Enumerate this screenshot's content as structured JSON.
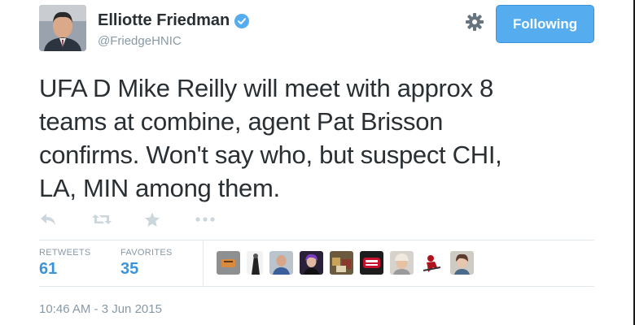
{
  "author": {
    "name": "Elliotte Friedman",
    "handle": "@FriedgeHNIC",
    "verified": true
  },
  "follow_button": {
    "label": "Following"
  },
  "tweet": {
    "lines": [
      "UFA D Mike Reilly will meet with approx 8",
      "teams at combine, agent Pat Brisson",
      "confirms. Won't say who, but suspect CHI,",
      "LA, MIN among them."
    ]
  },
  "actions": [
    "reply-icon",
    "retweet-icon",
    "favorite-icon",
    "more-icon"
  ],
  "stats": {
    "retweets": {
      "label": "RETWEETS",
      "value": "61"
    },
    "favorites": {
      "label": "FAVORITES",
      "value": "35"
    }
  },
  "timestamp": "10:46 AM - 3 Jun 2015",
  "colors": {
    "accent": "#55acee",
    "stat_value": "#3b94d9",
    "muted": "#8899a6",
    "text": "#292f33"
  }
}
